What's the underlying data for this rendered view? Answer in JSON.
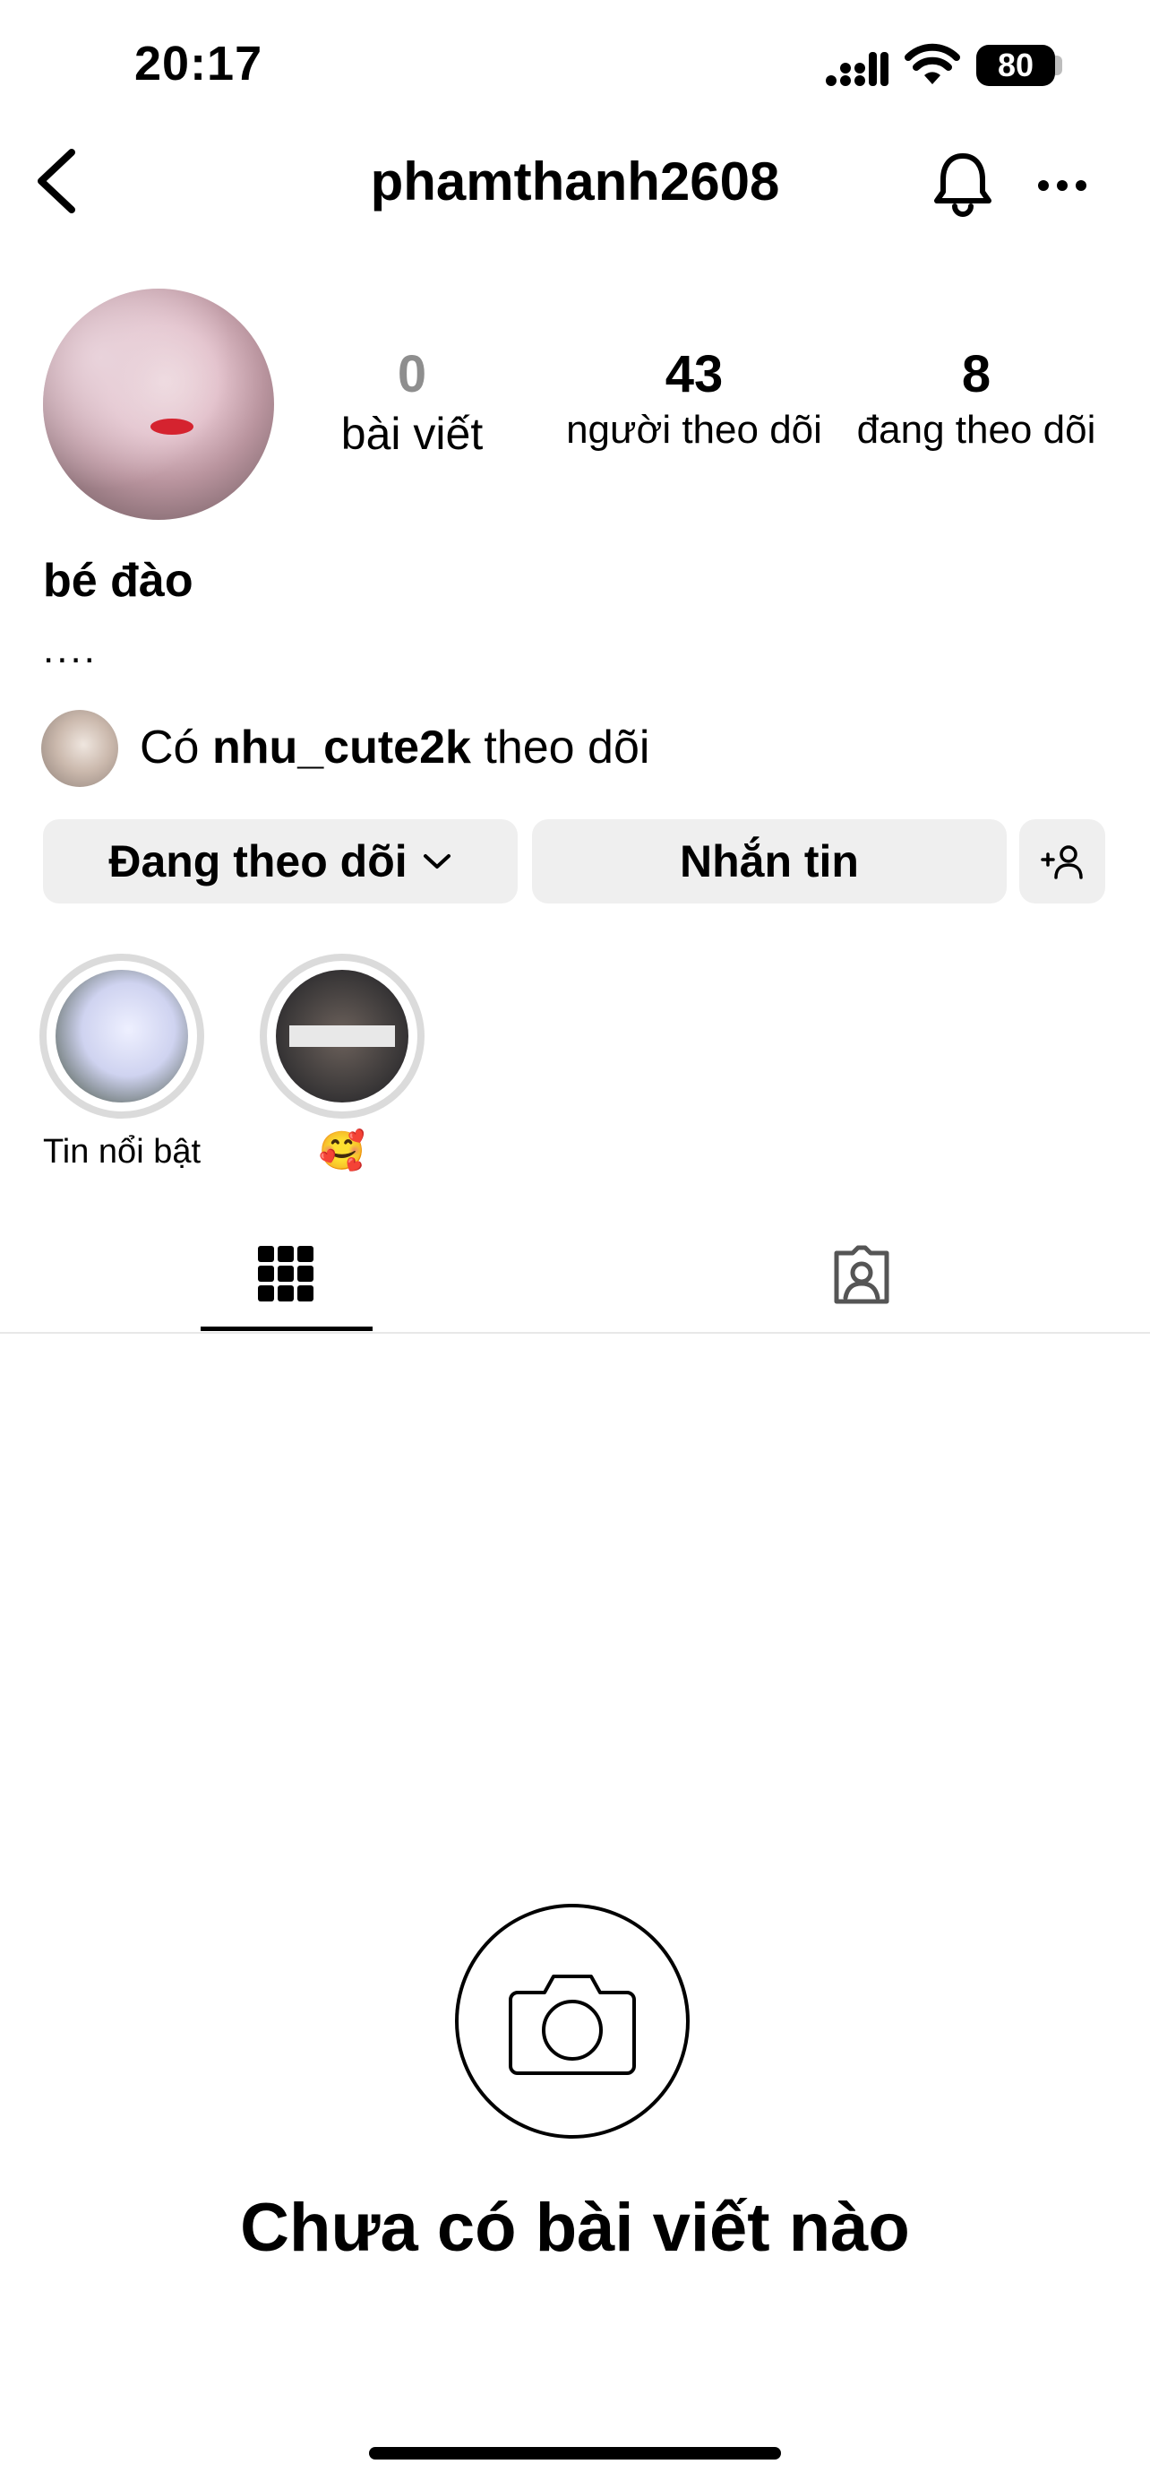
{
  "status_bar": {
    "time": "20:17",
    "battery": "80"
  },
  "header": {
    "username": "phamthanh2608"
  },
  "profile": {
    "stats": [
      {
        "value": "0",
        "label": "bài viết"
      },
      {
        "value": "43",
        "label": "người theo dõi"
      },
      {
        "value": "8",
        "label": "đang theo dõi"
      }
    ],
    "display_name": "bé đào",
    "bio": "....",
    "mutual": {
      "prefix": "Có",
      "username": "nhu_cute2k",
      "suffix": "theo dõi"
    }
  },
  "actions": {
    "following": "Đang theo dõi",
    "message": "Nhắn tin"
  },
  "highlights": [
    {
      "label": "Tin nổi bật"
    },
    {
      "label": "🥰"
    }
  ],
  "empty_state": {
    "title": "Chưa có bài viết nào"
  }
}
